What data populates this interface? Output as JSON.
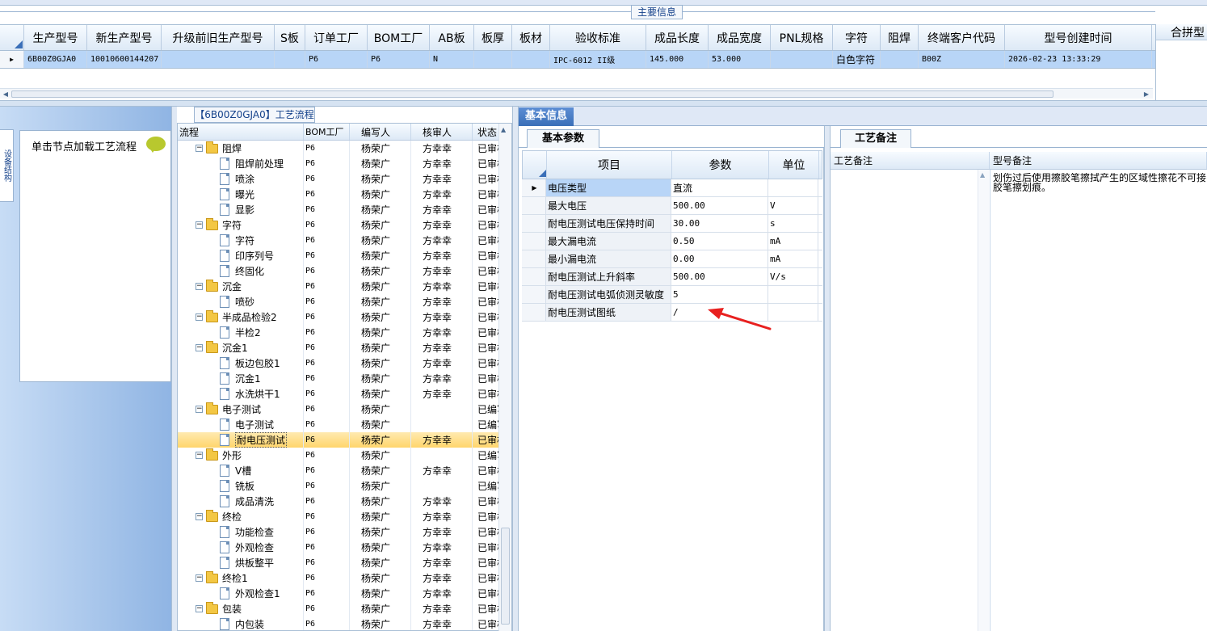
{
  "top": {
    "main_info_tab": "主要信息",
    "columns": [
      "生产型号",
      "新生产型号",
      "升级前旧生产型号",
      "S板",
      "订单工厂",
      "BOM工厂",
      "AB板",
      "板厚",
      "板材",
      "验收标准",
      "成品长度",
      "成品宽度",
      "PNL规格",
      "字符",
      "阻焊",
      "终端客户代码",
      "型号创建时间"
    ],
    "row": [
      "6B00Z0GJA0",
      "10010600144207",
      "",
      "",
      "P6",
      "P6",
      "N",
      "",
      "",
      "IPC-6012 II级",
      "145.000",
      "53.000",
      "",
      "白色字符",
      "",
      "B00Z",
      "2026-02-23 13:33:29"
    ],
    "right_panel_label": "合拼型"
  },
  "left": {
    "side_tab": "设备结构",
    "load_label": "单击节点加载工艺流程"
  },
  "process": {
    "title": "【6B00Z0GJA0】工艺流程",
    "columns": [
      "流程",
      "BOM工厂",
      "编写人",
      "核审人",
      "状态"
    ],
    "rows": [
      {
        "level": 1,
        "type": "folder",
        "name": "阻焊",
        "bom": "P6",
        "writer": "杨荣广",
        "reviewer": "方幸幸",
        "status": "已审核"
      },
      {
        "level": 2,
        "type": "doc",
        "name": "阻焊前处理",
        "bom": "P6",
        "writer": "杨荣广",
        "reviewer": "方幸幸",
        "status": "已审核"
      },
      {
        "level": 2,
        "type": "doc",
        "name": "喷涂",
        "bom": "P6",
        "writer": "杨荣广",
        "reviewer": "方幸幸",
        "status": "已审核"
      },
      {
        "level": 2,
        "type": "doc",
        "name": "曝光",
        "bom": "P6",
        "writer": "杨荣广",
        "reviewer": "方幸幸",
        "status": "已审核"
      },
      {
        "level": 2,
        "type": "doc",
        "name": "显影",
        "bom": "P6",
        "writer": "杨荣广",
        "reviewer": "方幸幸",
        "status": "已审核"
      },
      {
        "level": 1,
        "type": "folder",
        "name": "字符",
        "bom": "P6",
        "writer": "杨荣广",
        "reviewer": "方幸幸",
        "status": "已审核"
      },
      {
        "level": 2,
        "type": "doc",
        "name": "字符",
        "bom": "P6",
        "writer": "杨荣广",
        "reviewer": "方幸幸",
        "status": "已审核"
      },
      {
        "level": 2,
        "type": "doc",
        "name": "印序列号",
        "bom": "P6",
        "writer": "杨荣广",
        "reviewer": "方幸幸",
        "status": "已审核"
      },
      {
        "level": 2,
        "type": "doc",
        "name": "终固化",
        "bom": "P6",
        "writer": "杨荣广",
        "reviewer": "方幸幸",
        "status": "已审核"
      },
      {
        "level": 1,
        "type": "folder",
        "name": "沉金",
        "bom": "P6",
        "writer": "杨荣广",
        "reviewer": "方幸幸",
        "status": "已审核"
      },
      {
        "level": 2,
        "type": "doc",
        "name": "喷砂",
        "bom": "P6",
        "writer": "杨荣广",
        "reviewer": "方幸幸",
        "status": "已审核"
      },
      {
        "level": 1,
        "type": "folder",
        "name": "半成品检验2",
        "bom": "P6",
        "writer": "杨荣广",
        "reviewer": "方幸幸",
        "status": "已审核"
      },
      {
        "level": 2,
        "type": "doc",
        "name": "半检2",
        "bom": "P6",
        "writer": "杨荣广",
        "reviewer": "方幸幸",
        "status": "已审核"
      },
      {
        "level": 1,
        "type": "folder",
        "name": "沉金1",
        "bom": "P6",
        "writer": "杨荣广",
        "reviewer": "方幸幸",
        "status": "已审核"
      },
      {
        "level": 2,
        "type": "doc",
        "name": "板边包胶1",
        "bom": "P6",
        "writer": "杨荣广",
        "reviewer": "方幸幸",
        "status": "已审核"
      },
      {
        "level": 2,
        "type": "doc",
        "name": "沉金1",
        "bom": "P6",
        "writer": "杨荣广",
        "reviewer": "方幸幸",
        "status": "已审核"
      },
      {
        "level": 2,
        "type": "doc",
        "name": "水洗烘干1",
        "bom": "P6",
        "writer": "杨荣广",
        "reviewer": "方幸幸",
        "status": "已审核"
      },
      {
        "level": 1,
        "type": "folder",
        "name": "电子测试",
        "bom": "P6",
        "writer": "杨荣广",
        "reviewer": "",
        "status": "已编写"
      },
      {
        "level": 2,
        "type": "doc",
        "name": "电子测试",
        "bom": "P6",
        "writer": "杨荣广",
        "reviewer": "",
        "status": "已编写"
      },
      {
        "level": 2,
        "type": "doc",
        "name": "耐电压测试",
        "bom": "P6",
        "writer": "杨荣广",
        "reviewer": "方幸幸",
        "status": "已审核",
        "selected": true
      },
      {
        "level": 1,
        "type": "folder",
        "name": "外形",
        "bom": "P6",
        "writer": "杨荣广",
        "reviewer": "",
        "status": "已编写"
      },
      {
        "level": 2,
        "type": "doc",
        "name": "V槽",
        "bom": "P6",
        "writer": "杨荣广",
        "reviewer": "方幸幸",
        "status": "已审核"
      },
      {
        "level": 2,
        "type": "doc",
        "name": "铣板",
        "bom": "P6",
        "writer": "杨荣广",
        "reviewer": "",
        "status": "已编写"
      },
      {
        "level": 2,
        "type": "doc",
        "name": "成品清洗",
        "bom": "P6",
        "writer": "杨荣广",
        "reviewer": "方幸幸",
        "status": "已审核"
      },
      {
        "level": 1,
        "type": "folder",
        "name": "终检",
        "bom": "P6",
        "writer": "杨荣广",
        "reviewer": "方幸幸",
        "status": "已审核"
      },
      {
        "level": 2,
        "type": "doc",
        "name": "功能检查",
        "bom": "P6",
        "writer": "杨荣广",
        "reviewer": "方幸幸",
        "status": "已审核"
      },
      {
        "level": 2,
        "type": "doc",
        "name": "外观检查",
        "bom": "P6",
        "writer": "杨荣广",
        "reviewer": "方幸幸",
        "status": "已审核"
      },
      {
        "level": 2,
        "type": "doc",
        "name": "烘板整平",
        "bom": "P6",
        "writer": "杨荣广",
        "reviewer": "方幸幸",
        "status": "已审核"
      },
      {
        "level": 1,
        "type": "folder",
        "name": "终检1",
        "bom": "P6",
        "writer": "杨荣广",
        "reviewer": "方幸幸",
        "status": "已审核"
      },
      {
        "level": 2,
        "type": "doc",
        "name": "外观检查1",
        "bom": "P6",
        "writer": "杨荣广",
        "reviewer": "方幸幸",
        "status": "已审核"
      },
      {
        "level": 1,
        "type": "folder",
        "name": "包装",
        "bom": "P6",
        "writer": "杨荣广",
        "reviewer": "方幸幸",
        "status": "已审核"
      },
      {
        "level": 2,
        "type": "doc",
        "name": "内包装",
        "bom": "P6",
        "writer": "杨荣广",
        "reviewer": "方幸幸",
        "status": "已审核"
      }
    ]
  },
  "basic": {
    "tab": "基本信息",
    "params_tab": "基本参数",
    "columns": [
      "项目",
      "参数",
      "单位"
    ],
    "rows": [
      {
        "item": "电压类型",
        "value": "直流",
        "unit": "",
        "selected": true
      },
      {
        "item": "最大电压",
        "value": "500.00",
        "unit": "V"
      },
      {
        "item": "耐电压测试电压保持时间",
        "value": "30.00",
        "unit": "s"
      },
      {
        "item": "最大漏电流",
        "value": "0.50",
        "unit": "mA"
      },
      {
        "item": "最小漏电流",
        "value": "0.00",
        "unit": "mA"
      },
      {
        "item": "耐电压测试上升斜率",
        "value": "500.00",
        "unit": "V/s"
      },
      {
        "item": "耐电压测试电弧侦测灵敏度",
        "value": "5",
        "unit": ""
      },
      {
        "item": "耐电压测试图纸",
        "value": "/",
        "unit": ""
      }
    ]
  },
  "notes": {
    "tab": "工艺备注",
    "col_craft": "工艺备注",
    "col_model": "型号备注",
    "model_note_line1": "划伤过后使用擦胶笔擦拭产生的区域性擦花不可接",
    "model_note_line2": "胶笔擦划痕。"
  },
  "colors": {
    "accent": "#3a6fb8",
    "selection": "#b8d5f7",
    "tree_selection": "#ffd56c",
    "arrow": "#e8201f"
  }
}
